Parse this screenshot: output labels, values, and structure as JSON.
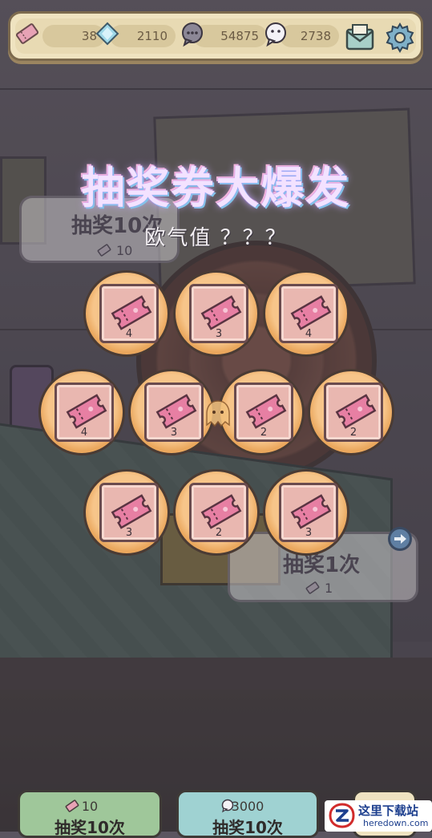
{
  "resources": {
    "tickets": "38",
    "gems": "2110",
    "chat_coins": "54875",
    "ghost_coins": "2738"
  },
  "icons": {
    "ticket": "ticket-icon",
    "gem": "gem-icon",
    "chat_coin": "chat-bubble-coin-icon",
    "ghost_coin": "ghost-bubble-coin-icon",
    "mail": "mail-icon",
    "settings": "gear-icon"
  },
  "left_panel": {
    "title": "抽奖10次",
    "cost": "10"
  },
  "event": {
    "title": "抽奖券大爆发",
    "luck_label": "欧气值 ？？？"
  },
  "rewards": [
    {
      "count": "4"
    },
    {
      "count": "3"
    },
    {
      "count": "4"
    },
    {
      "count": "4"
    },
    {
      "count": "3"
    },
    {
      "count": "2"
    },
    {
      "count": "2"
    },
    {
      "count": "3"
    },
    {
      "count": "2"
    },
    {
      "count": "3"
    }
  ],
  "right_panel": {
    "title": "抽奖1次",
    "cost": "1"
  },
  "bottom_buttons": {
    "ticket_draw": {
      "cost": "10",
      "label": "抽奖10次"
    },
    "coin_draw": {
      "cost": "3000",
      "label": "抽奖10次"
    }
  },
  "watermark": {
    "name": "这里下载站",
    "url": "heredown.com"
  },
  "colors": {
    "token_orange": "#f4b874",
    "ticket_pink": "#e9b7b0",
    "topbar_cream": "#efe3c0",
    "green_button": "#9fc79a",
    "teal_button": "#9fd2d2"
  }
}
